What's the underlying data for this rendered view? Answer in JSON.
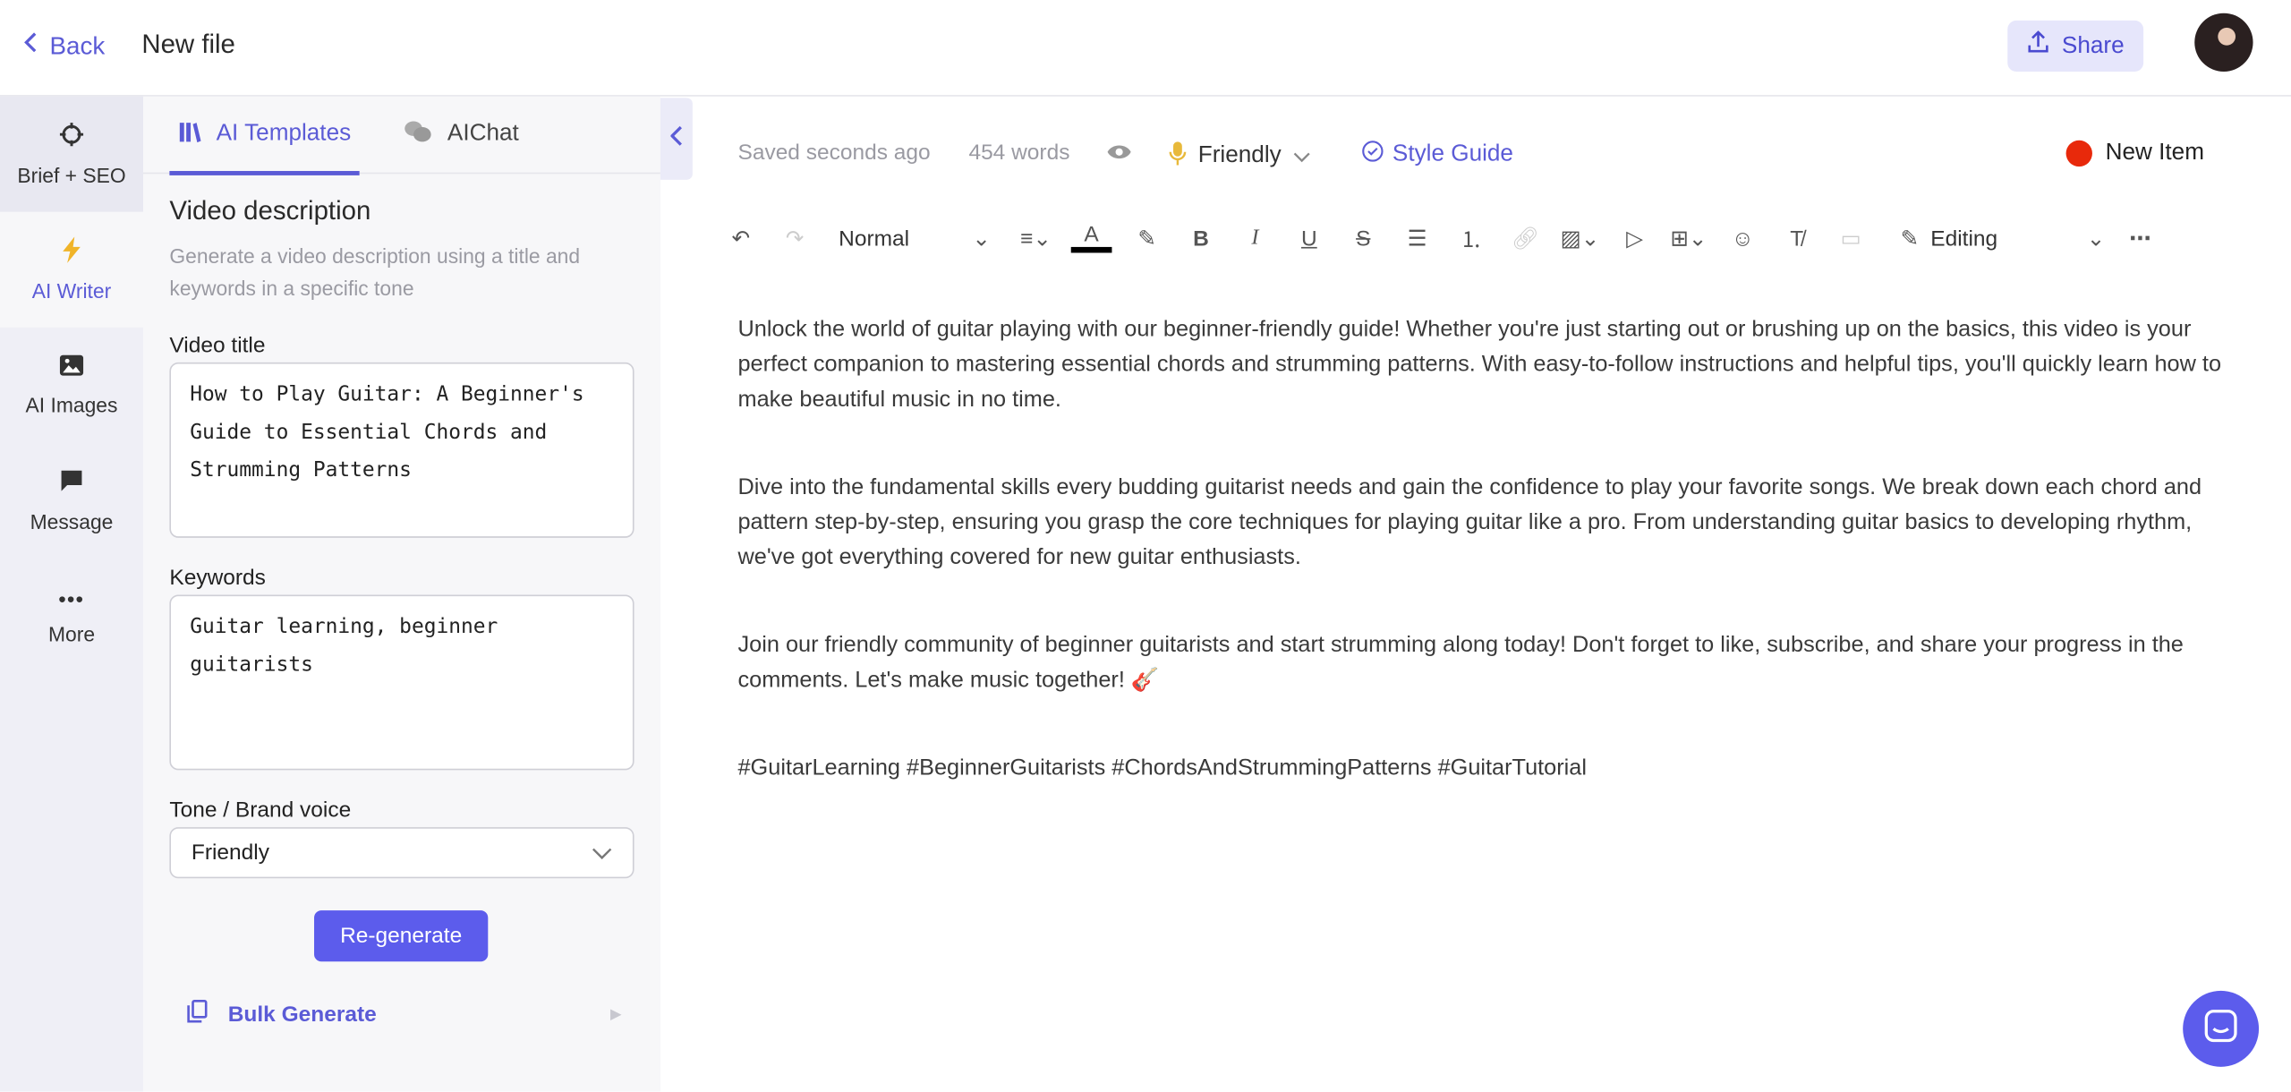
{
  "header": {
    "back_label": "Back",
    "title": "New file",
    "share_label": "Share"
  },
  "rail": {
    "items": [
      {
        "label": "Brief + SEO",
        "icon": "crosshair-icon"
      },
      {
        "label": "AI Writer",
        "icon": "lightning-icon"
      },
      {
        "label": "AI Images",
        "icon": "image-icon"
      },
      {
        "label": "Message",
        "icon": "message-icon"
      },
      {
        "label": "More",
        "icon": "more-icon"
      }
    ]
  },
  "panel": {
    "tabs": [
      {
        "label": "AI Templates"
      },
      {
        "label": "AIChat"
      }
    ],
    "title": "Video description",
    "description": "Generate a video description using a title and keywords in a specific tone",
    "video_title_label": "Video title",
    "video_title_value": "How to Play Guitar: A Beginner's Guide to Essential Chords and Strumming Patterns",
    "keywords_label": "Keywords",
    "keywords_value": "Guitar learning, beginner guitarists",
    "tone_label": "Tone / Brand voice",
    "tone_value": "Friendly",
    "regenerate_label": "Re-generate",
    "bulk_label": "Bulk Generate"
  },
  "editor": {
    "saved_status": "Saved seconds ago",
    "word_count": "454 words",
    "tone": "Friendly",
    "style_guide": "Style Guide",
    "new_item": "New Item",
    "toolbar": {
      "block_style": "Normal",
      "mode": "Editing"
    },
    "paragraphs": [
      "Unlock the world of guitar playing with our beginner-friendly guide! Whether you're just starting out or brushing up on the basics, this video is your perfect companion to mastering essential chords and strumming patterns. With easy-to-follow instructions and helpful tips, you'll quickly learn how to make beautiful music in no time.",
      "Dive into the fundamental skills every budding guitarist needs and gain the confidence to play your favorite songs. We break down each chord and pattern step-by-step, ensuring you grasp the core techniques for playing guitar like a pro. From understanding guitar basics to developing rhythm, we've got everything covered for new guitar enthusiasts.",
      "Join our friendly community of beginner guitarists and start strumming along today! Don't forget to like, subscribe, and share your progress in the comments. Let's make music together! 🎸",
      "#GuitarLearning #BeginnerGuitarists #ChordsAndStrummingPatterns #GuitarTutorial"
    ]
  },
  "colors": {
    "accent": "#5b5bd6",
    "new_item_dot": "#e8290b",
    "tone_icon": "#e8b93a"
  }
}
